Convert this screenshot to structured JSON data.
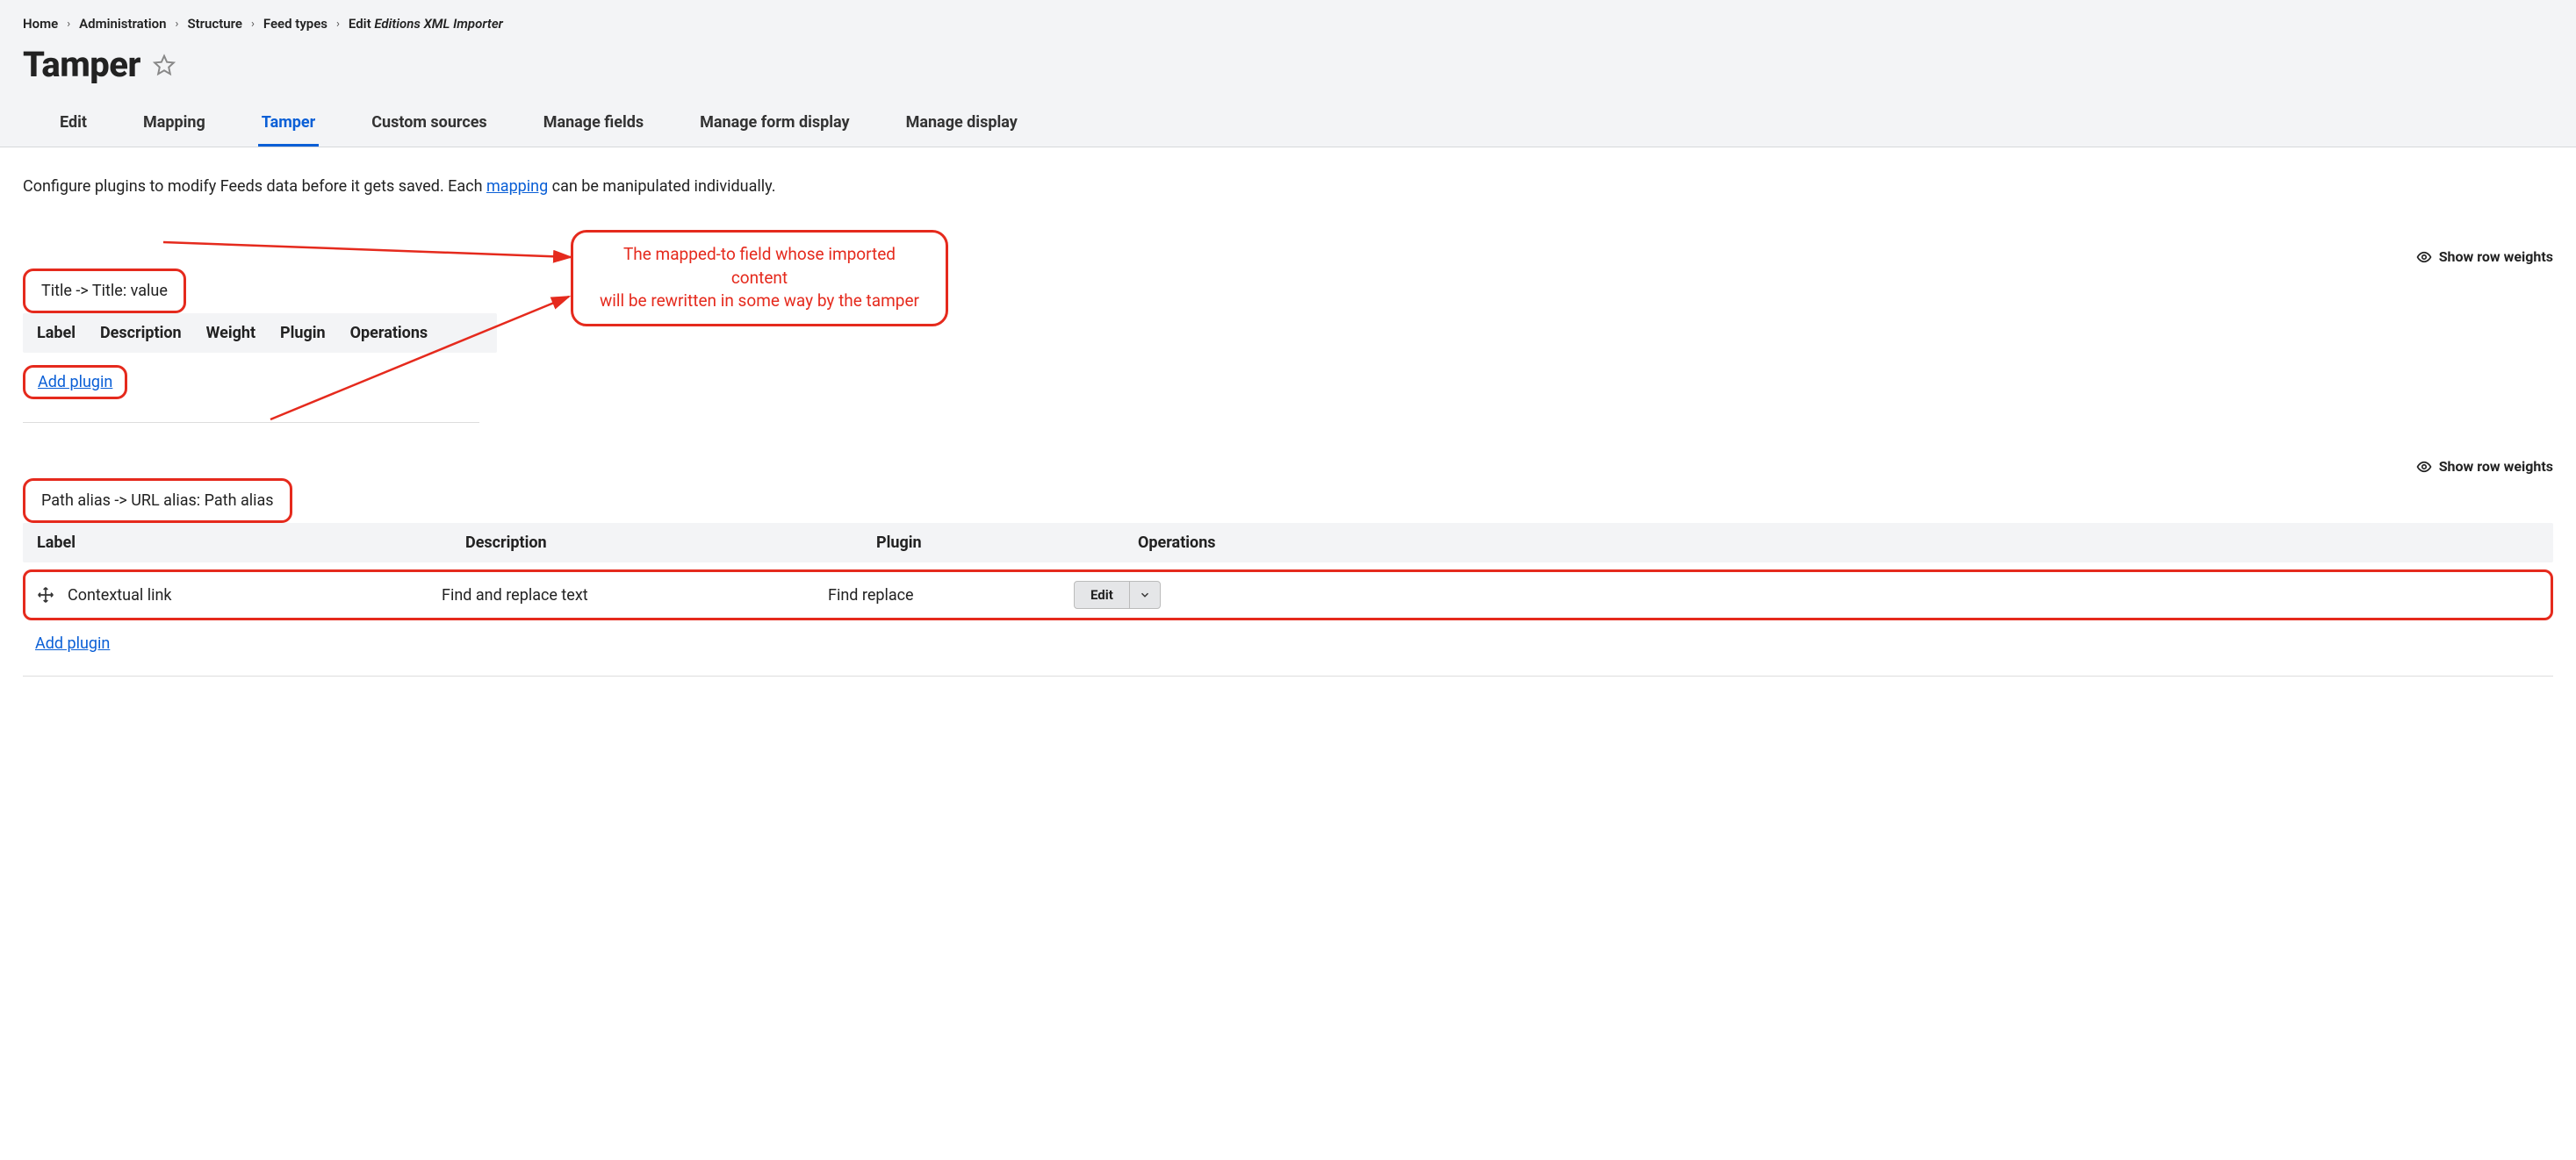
{
  "breadcrumb": {
    "items": [
      "Home",
      "Administration",
      "Structure",
      "Feed types"
    ],
    "lastPrefix": "Edit",
    "lastEm": "Editions XML Importer"
  },
  "pageTitle": "Tamper",
  "tabs": [
    {
      "label": "Edit",
      "active": false
    },
    {
      "label": "Mapping",
      "active": false
    },
    {
      "label": "Tamper",
      "active": true
    },
    {
      "label": "Custom sources",
      "active": false
    },
    {
      "label": "Manage fields",
      "active": false
    },
    {
      "label": "Manage form display",
      "active": false
    },
    {
      "label": "Manage display",
      "active": false
    }
  ],
  "intro": {
    "before": "Configure plugins to modify Feeds data before it gets saved. Each ",
    "link": "mapping",
    "after": " can be manipulated individually."
  },
  "showRowWeights": "Show row weights",
  "callout": {
    "line1": "The mapped-to field whose imported content",
    "line2": "will be rewritten in some way by the tamper"
  },
  "groups": [
    {
      "title": "Title -> Title: value",
      "compactHeaders": [
        "Label",
        "Description",
        "Weight",
        "Plugin",
        "Operations"
      ],
      "addPlugin": "Add plugin",
      "rows": []
    },
    {
      "title": "Path alias -> URL alias: Path alias",
      "fullHeaders": {
        "label": "Label",
        "description": "Description",
        "plugin": "Plugin",
        "operations": "Operations"
      },
      "addPlugin": "Add plugin",
      "rows": [
        {
          "label": "Contextual link",
          "description": "Find and replace text",
          "plugin": "Find replace",
          "opLabel": "Edit"
        }
      ]
    }
  ]
}
